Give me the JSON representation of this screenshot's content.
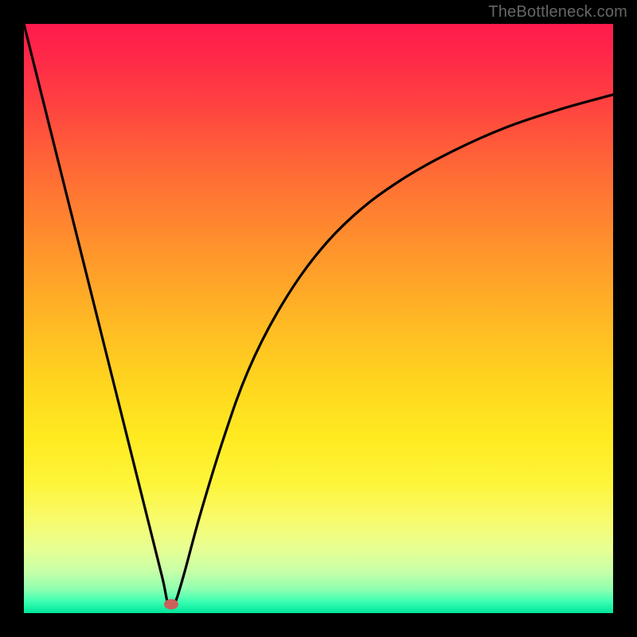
{
  "watermark": "TheBottleneck.com",
  "chart_data": {
    "type": "line",
    "title": "",
    "xlabel": "",
    "ylabel": "",
    "xlim": [
      0,
      100
    ],
    "ylim": [
      0,
      100
    ],
    "series": [
      {
        "name": "curve",
        "x": [
          0,
          3,
          6,
          9,
          12,
          15,
          18,
          21,
          23.5,
          24.5,
          25.5,
          27,
          30,
          34,
          38,
          43,
          49,
          56,
          64,
          73,
          82,
          91,
          100
        ],
        "y": [
          100,
          88,
          76,
          64,
          52,
          40,
          28,
          16,
          6,
          1.5,
          1.5,
          6,
          17,
          30,
          41,
          51,
          60,
          67.5,
          73.5,
          78.5,
          82.5,
          85.5,
          88
        ]
      }
    ],
    "annotations": [
      {
        "name": "min-dot",
        "x": 25,
        "y": 1.5
      }
    ],
    "background_gradient": {
      "top_color": "#ff1a4d",
      "mid_color": "#ffd81f",
      "bottom_color": "#00e69a"
    }
  }
}
